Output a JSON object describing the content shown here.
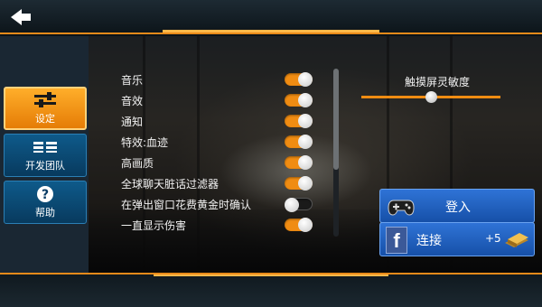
{
  "nav": {
    "back_icon": "back-arrow-icon"
  },
  "sidebar": {
    "items": [
      {
        "label": "设定",
        "icon": "sliders-icon",
        "active": true
      },
      {
        "label": "开发团队",
        "icon": "team-icon",
        "active": false
      },
      {
        "label": "帮助",
        "icon": "help-icon",
        "active": false
      }
    ]
  },
  "settings": [
    {
      "label": "音乐",
      "on": true
    },
    {
      "label": "音效",
      "on": true
    },
    {
      "label": "通知",
      "on": true
    },
    {
      "label": "特效:血迹",
      "on": true
    },
    {
      "label": "高画质",
      "on": true
    },
    {
      "label": "全球聊天脏话过滤器",
      "on": true
    },
    {
      "label": "在弹出窗口花费黄金时确认",
      "on": false
    },
    {
      "label": "一直显示伤害",
      "on": true
    }
  ],
  "sensitivity": {
    "label": "触摸屏灵敏度",
    "value": 0.5
  },
  "scroll": {
    "position": 0.0,
    "visible_fraction": 0.6
  },
  "login_button": {
    "label": "登入",
    "icon": "gamepad-icon"
  },
  "connect_button": {
    "label": "连接",
    "icon": "facebook-icon",
    "fb_glyph": "f",
    "reward": "+5",
    "reward_icon": "gold-bar-icon"
  },
  "colors": {
    "accent": "#f08c12",
    "panel_blue": "#1650a8",
    "sidebar_active": "#ffae2a"
  }
}
